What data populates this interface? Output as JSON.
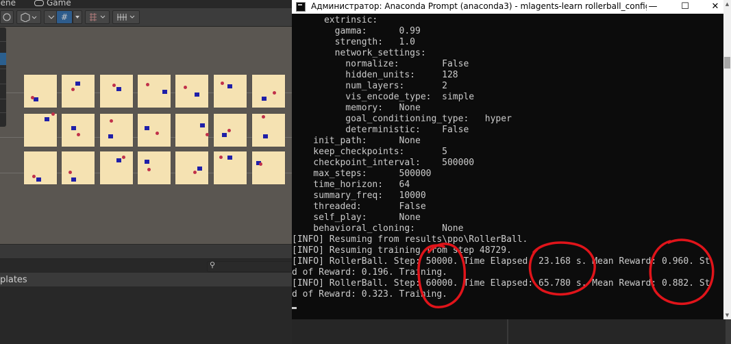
{
  "unity": {
    "tabs": {
      "scene": "cene",
      "game": "Game"
    },
    "toolbar": {
      "grid_glyph": "#"
    },
    "templates_label": "plates",
    "search_glyph": "⚲"
  },
  "console": {
    "title": "Администратор: Anaconda Prompt (anaconda3) - mlagents-learn  rollerball_config.yaml",
    "minimize": "—",
    "maximize": "☐",
    "close": "✕",
    "lines": [
      "      extrinsic:",
      "        gamma:      0.99",
      "        strength:   1.0",
      "        network_settings:",
      "          normalize:        False",
      "          hidden_units:     128",
      "          num_layers:       2",
      "          vis_encode_type:  simple",
      "          memory:   None",
      "          goal_conditioning_type:   hyper",
      "          deterministic:    False",
      "    init_path:      None",
      "    keep_checkpoints:       5",
      "    checkpoint_interval:    500000",
      "    max_steps:      500000",
      "    time_horizon:   64",
      "    summary_freq:   10000",
      "    threaded:       False",
      "    self_play:      None",
      "    behavioral_cloning:     None",
      "[INFO] Resuming from results\\ppo\\RollerBall.",
      "[INFO] Resuming training from step 48729.",
      "[INFO] RollerBall. Step: 50000. Time Elapsed: 23.168 s. Mean Reward: 0.960. St",
      "d of Reward: 0.196. Training.",
      "[INFO] RollerBall. Step: 60000. Time Elapsed: 65.780 s. Mean Reward: 0.882. St",
      "d of Reward: 0.323. Training."
    ]
  },
  "colors": {
    "annotation": "#e0141a",
    "console_bg": "#0c0c0c",
    "console_text": "#cccccc",
    "tile": "#f5e2b2"
  }
}
